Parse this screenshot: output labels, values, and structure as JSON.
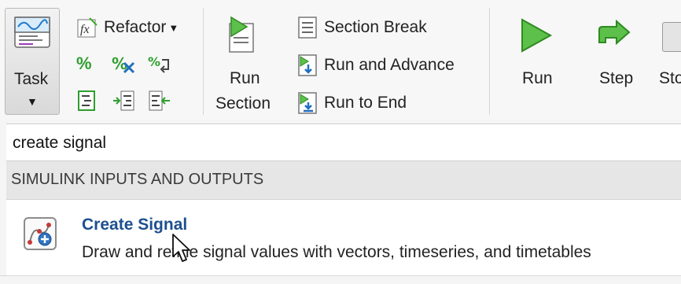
{
  "toolstrip": {
    "task": {
      "label": "Task",
      "dropdown": "▼"
    },
    "refactor": {
      "label": "Refactor",
      "dropdown": "▼"
    },
    "run_section": {
      "line1": "Run",
      "line2": "Section"
    },
    "section_break": {
      "label": "Section Break"
    },
    "run_and_advance": {
      "label": "Run and Advance"
    },
    "run_to_end": {
      "label": "Run to End"
    },
    "run": {
      "label": "Run"
    },
    "step": {
      "label": "Step"
    },
    "stop": {
      "label": "Sto"
    }
  },
  "search": {
    "value": "create signal"
  },
  "results": {
    "category": "SIMULINK INPUTS AND OUTPUTS",
    "items": [
      {
        "title": "Create Signal",
        "description": "Draw and refine signal values with vectors, timeseries, and timetables",
        "icon": "create-signal-icon"
      }
    ]
  },
  "colors": {
    "accent_title": "#1d4f8f",
    "run_green": "#3fae2a",
    "header_bg": "#e6e6e6"
  }
}
